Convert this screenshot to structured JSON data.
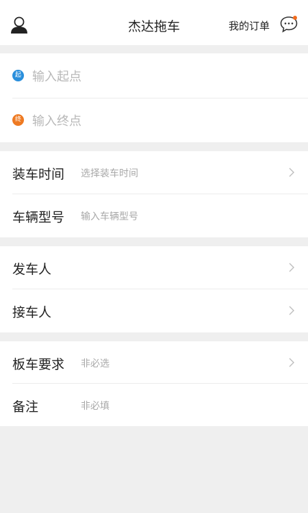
{
  "header": {
    "title": "杰达拖车",
    "orders_label": "我的订单",
    "notification_color": "#f26b1d"
  },
  "route": {
    "start": {
      "badge": "起",
      "placeholder": "输入起点",
      "color": "#2a8fdc"
    },
    "end": {
      "badge": "终",
      "placeholder": "输入终点",
      "color": "#ee7a22"
    }
  },
  "groups": [
    [
      {
        "label": "装车时间",
        "hint": "选择装车时间",
        "chevron": true
      },
      {
        "label": "车辆型号",
        "hint": "输入车辆型号",
        "chevron": false
      }
    ],
    [
      {
        "label": "发车人",
        "hint": "",
        "chevron": true
      },
      {
        "label": "接车人",
        "hint": "",
        "chevron": true
      }
    ],
    [
      {
        "label": "板车要求",
        "hint": "非必选",
        "chevron": true
      },
      {
        "label": "备注",
        "hint": "非必填",
        "chevron": false
      }
    ]
  ]
}
